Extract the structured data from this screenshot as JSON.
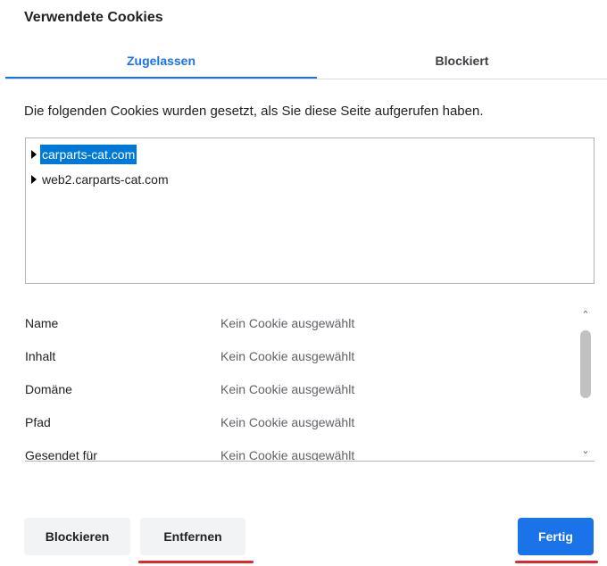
{
  "dialog": {
    "title": "Verwendete Cookies"
  },
  "tabs": [
    {
      "label": "Zugelassen",
      "active": true
    },
    {
      "label": "Blockiert",
      "active": false
    }
  ],
  "description": "Die folgenden Cookies wurden gesetzt, als Sie diese Seite aufgerufen haben.",
  "tree": {
    "items": [
      {
        "label": "carparts-cat.com",
        "selected": true
      },
      {
        "label": "web2.carparts-cat.com",
        "selected": false
      }
    ]
  },
  "details": {
    "rows": [
      {
        "key": "Name",
        "value": "Kein Cookie ausgewählt"
      },
      {
        "key": "Inhalt",
        "value": "Kein Cookie ausgewählt"
      },
      {
        "key": "Domäne",
        "value": "Kein Cookie ausgewählt"
      },
      {
        "key": "Pfad",
        "value": "Kein Cookie ausgewählt"
      },
      {
        "key": "Gesendet für",
        "value": "Kein Cookie ausgewählt"
      }
    ]
  },
  "buttons": {
    "block": "Blockieren",
    "remove": "Entfernen",
    "done": "Fertig"
  },
  "colors": {
    "accent": "#1a73e8",
    "selection": "#0078d7",
    "annotation": "#e3262b"
  }
}
